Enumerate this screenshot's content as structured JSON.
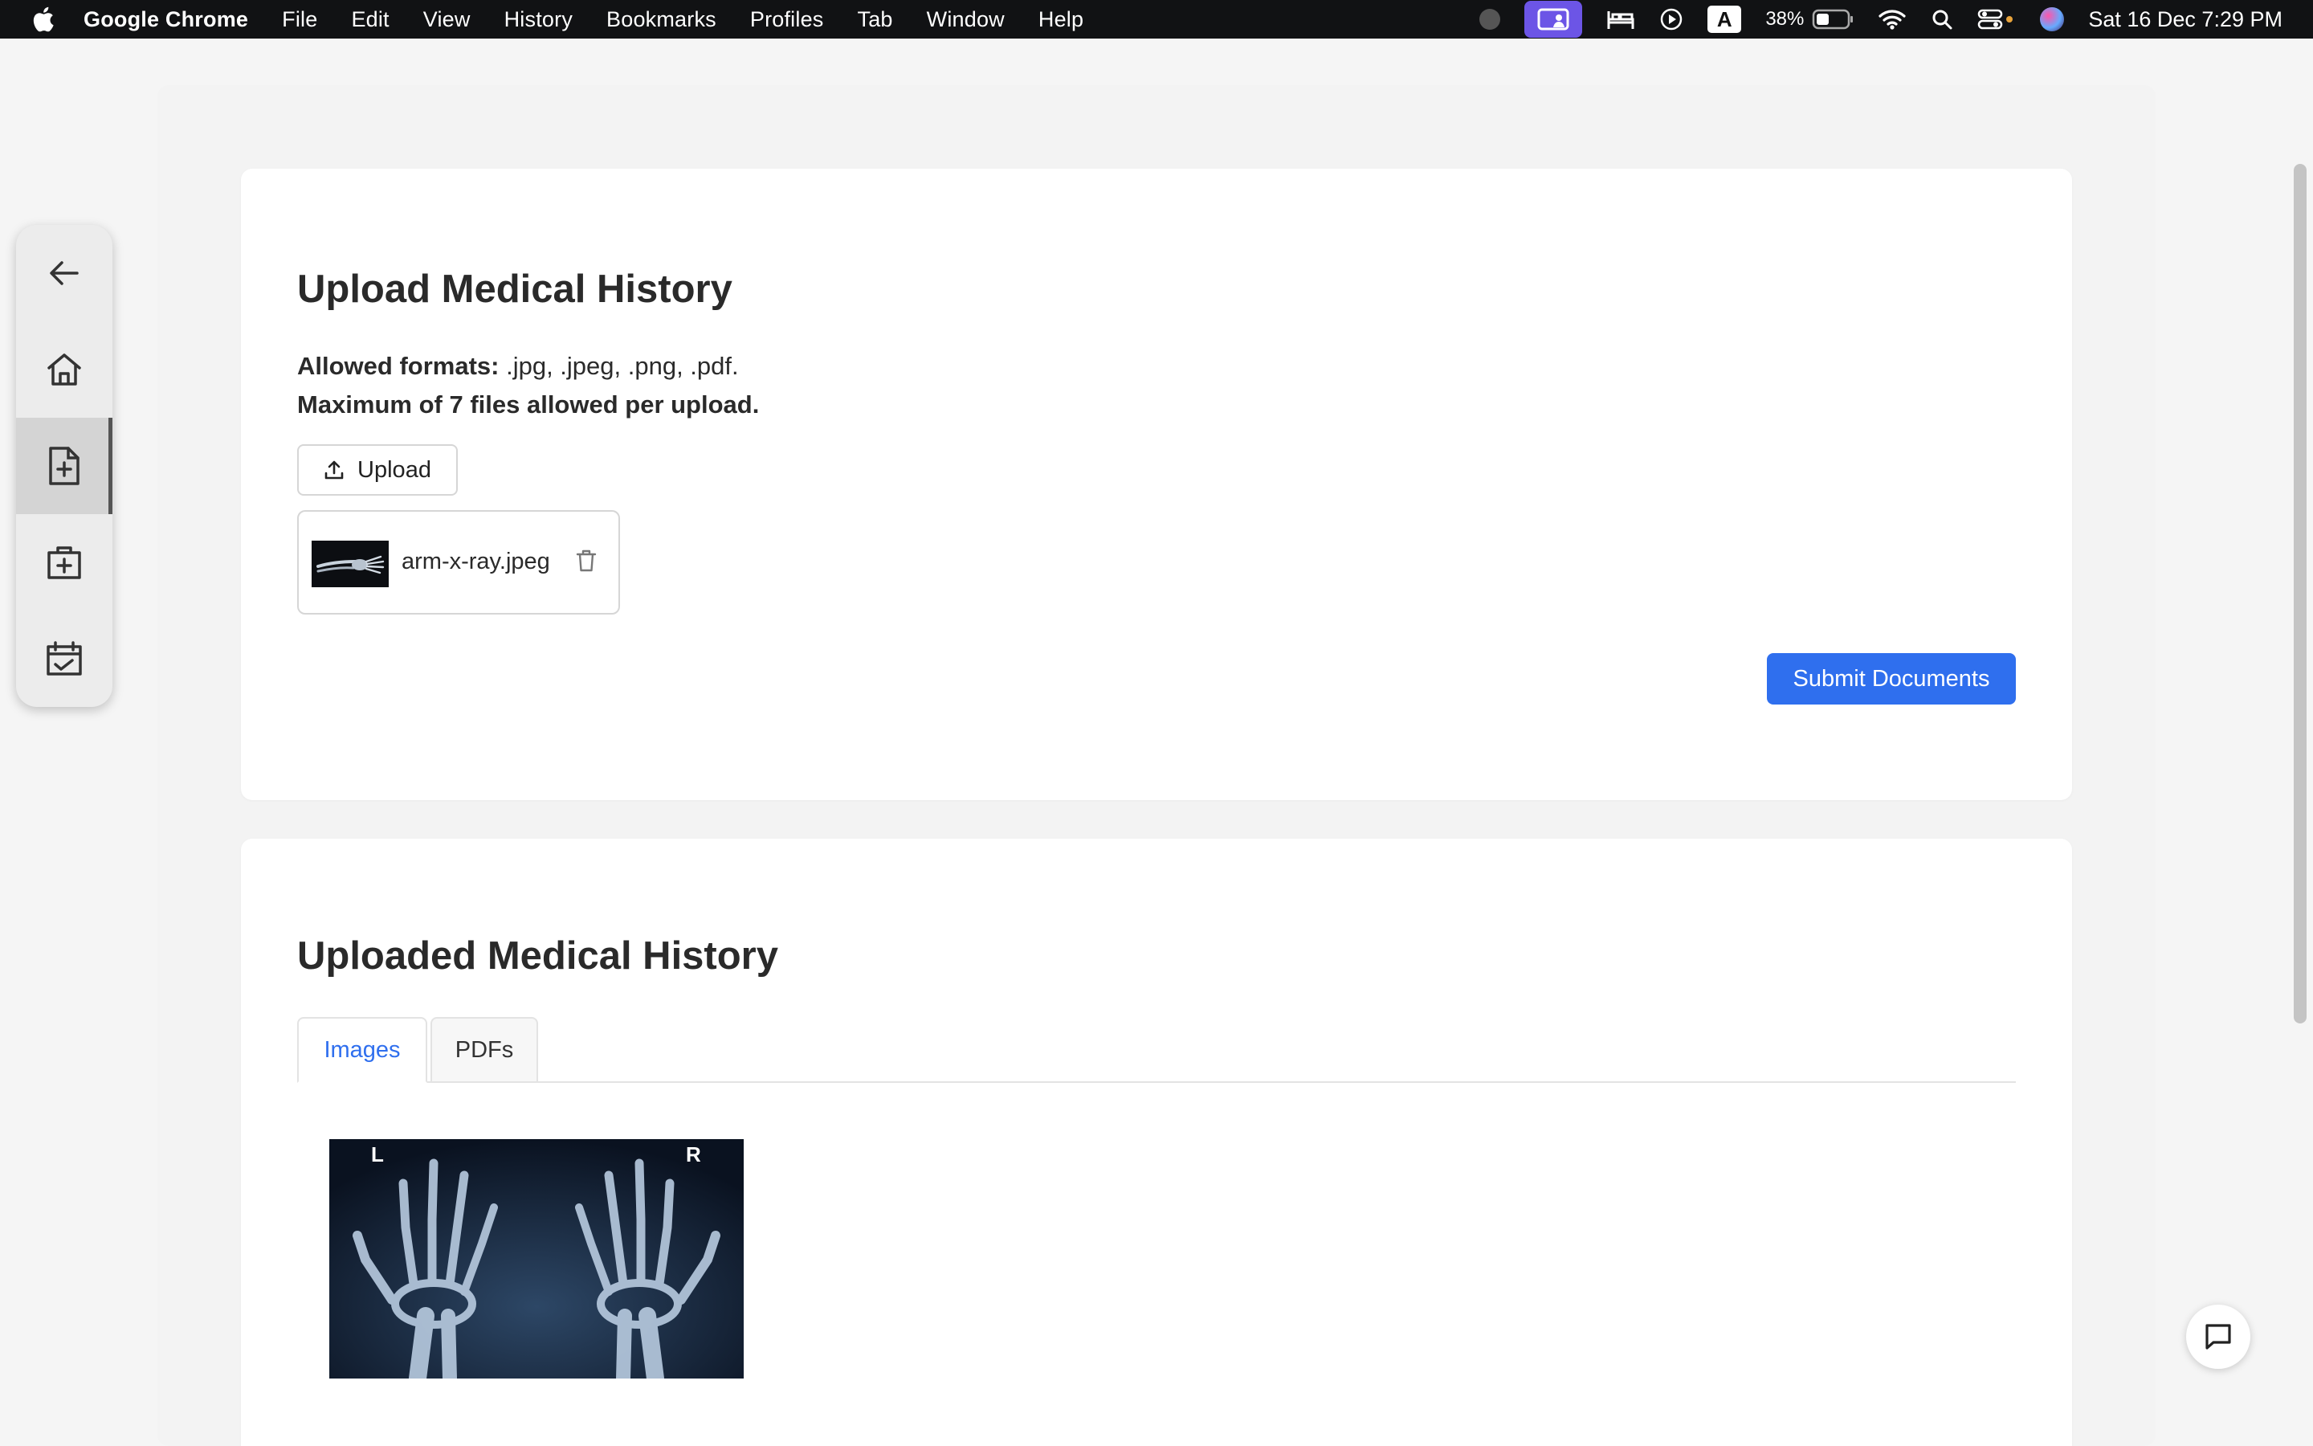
{
  "menubar": {
    "app_name": "Google Chrome",
    "items": [
      "File",
      "Edit",
      "View",
      "History",
      "Bookmarks",
      "Profiles",
      "Tab",
      "Window",
      "Help"
    ],
    "battery": "38%",
    "clock": "Sat 16 Dec  7:29 PM",
    "screen_share_color": "#6c55e6"
  },
  "sidenav": {
    "items": [
      {
        "name": "back",
        "icon": "arrow-left-icon"
      },
      {
        "name": "home",
        "icon": "home-icon"
      },
      {
        "name": "medical-history",
        "icon": "file-plus-icon",
        "active": true
      },
      {
        "name": "medical-kit",
        "icon": "medical-kit-icon"
      },
      {
        "name": "appointments",
        "icon": "calendar-check-icon"
      }
    ]
  },
  "upload_card": {
    "title": "Upload Medical History",
    "formats_label": "Allowed formats:",
    "formats_value": " .jpg, .jpeg, .png, .pdf.",
    "max_files": "Maximum of 7 files allowed per upload.",
    "upload_label": "Upload",
    "file": {
      "name": "arm-x-ray.jpeg"
    },
    "submit_label": "Submit Documents",
    "accent_color": "#2f6fee"
  },
  "uploaded_card": {
    "title": "Uploaded Medical History",
    "tabs": [
      {
        "label": "Images",
        "active": true
      },
      {
        "label": "PDFs",
        "active": false
      }
    ],
    "image_markers": {
      "left": "L",
      "right": "R"
    }
  }
}
